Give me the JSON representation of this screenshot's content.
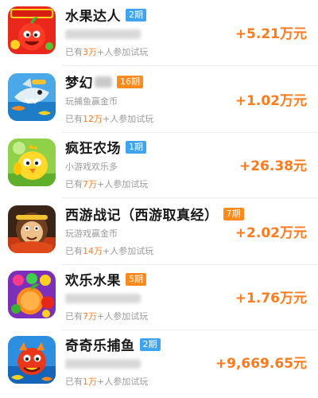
{
  "rows": [
    {
      "title": "水果达人",
      "badge": "2期",
      "badge_color": "#3ea3f0",
      "subtitle": "",
      "players_prefix": "已有",
      "players_count": "3万",
      "players_suffix": "+人参加试玩",
      "amount": "+5.21万元",
      "icon": "fruit-master-game-icon"
    },
    {
      "title": "梦幻",
      "badge": "16期",
      "badge_color": "#ff8a1c",
      "subtitle": "玩捕鱼赢金币",
      "players_prefix": "已有",
      "players_count": "12万",
      "players_suffix": "+人参加试玩",
      "amount": "+1.02万元",
      "icon": "fishing-shark-game-icon"
    },
    {
      "title": "疯狂农场",
      "badge": "1期",
      "badge_color": "#3ea3f0",
      "subtitle": "小游戏欢乐多",
      "players_prefix": "已有",
      "players_count": "7万",
      "players_suffix": "+人参加试玩",
      "amount": "+26.38元",
      "icon": "crazy-farm-chick-game-icon"
    },
    {
      "title": "西游战记（西游取真经）",
      "badge": "7期",
      "badge_color": "#ff8a1c",
      "subtitle": "玩游戏赢金币",
      "players_prefix": "已有",
      "players_count": "14万",
      "players_suffix": "+人参加试玩",
      "amount": "+2.02万元",
      "icon": "journey-west-monkey-game-icon"
    },
    {
      "title": "欢乐水果",
      "badge": "5期",
      "badge_color": "#ff8a1c",
      "subtitle": "",
      "players_prefix": "已有",
      "players_count": "7万",
      "players_suffix": "+人参加试玩",
      "amount": "+1.76万元",
      "icon": "happy-fruit-game-icon"
    },
    {
      "title": "奇奇乐捕鱼",
      "badge": "2期",
      "badge_color": "#3ea3f0",
      "subtitle": "",
      "players_prefix": "已有",
      "players_count": "1万",
      "players_suffix": "+人参加试玩",
      "amount": "+9,669.65元",
      "icon": "qiqile-fishing-dragon-game-icon"
    }
  ]
}
